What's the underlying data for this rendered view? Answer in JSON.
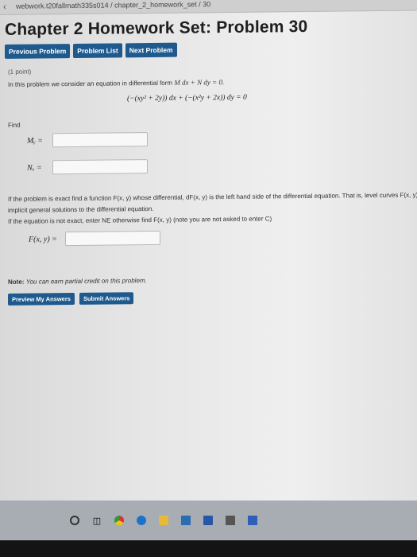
{
  "browser": {
    "url": "webwork.t20fallmath335s014 / chapter_2_homework_set / 30"
  },
  "page": {
    "title": "Chapter 2 Homework Set: Problem 30"
  },
  "nav": {
    "previous": "Previous Problem",
    "list": "Problem List",
    "next": "Next Problem"
  },
  "problem": {
    "points": "(1 point)",
    "intro_text": "In this problem we consider an equation in differential form",
    "intro_math": "M dx + N dy = 0.",
    "equation": "(−(xy² + 2y)) dx + (−(x²y + 2x)) dy = 0",
    "find_label": "Find",
    "my_label": "Mᵧ =",
    "nx_label": "Nₓ =",
    "desc_line1": "If the problem is exact find a function F(x, y) whose differential, dF(x, y) is the left hand side of the differential equation. That is, level curves F(x, y) = C, give",
    "desc_line2": "implicit general solutions to the differential equation.",
    "desc_line3": "If the equation is not exact, enter NE otherwise find F(x, y) (note you are not asked to enter C)",
    "f_label": "F(x, y) ="
  },
  "note": {
    "label": "Note:",
    "text": "You can earn partial credit on this problem."
  },
  "actions": {
    "preview": "Preview My Answers",
    "submit": "Submit Answers"
  },
  "taskbar": {
    "icons": [
      "start-icon",
      "task-view-icon",
      "chrome-icon",
      "edge-icon",
      "file-explorer-icon",
      "store-icon",
      "word-icon",
      "calculator-icon",
      "app-icon"
    ]
  }
}
